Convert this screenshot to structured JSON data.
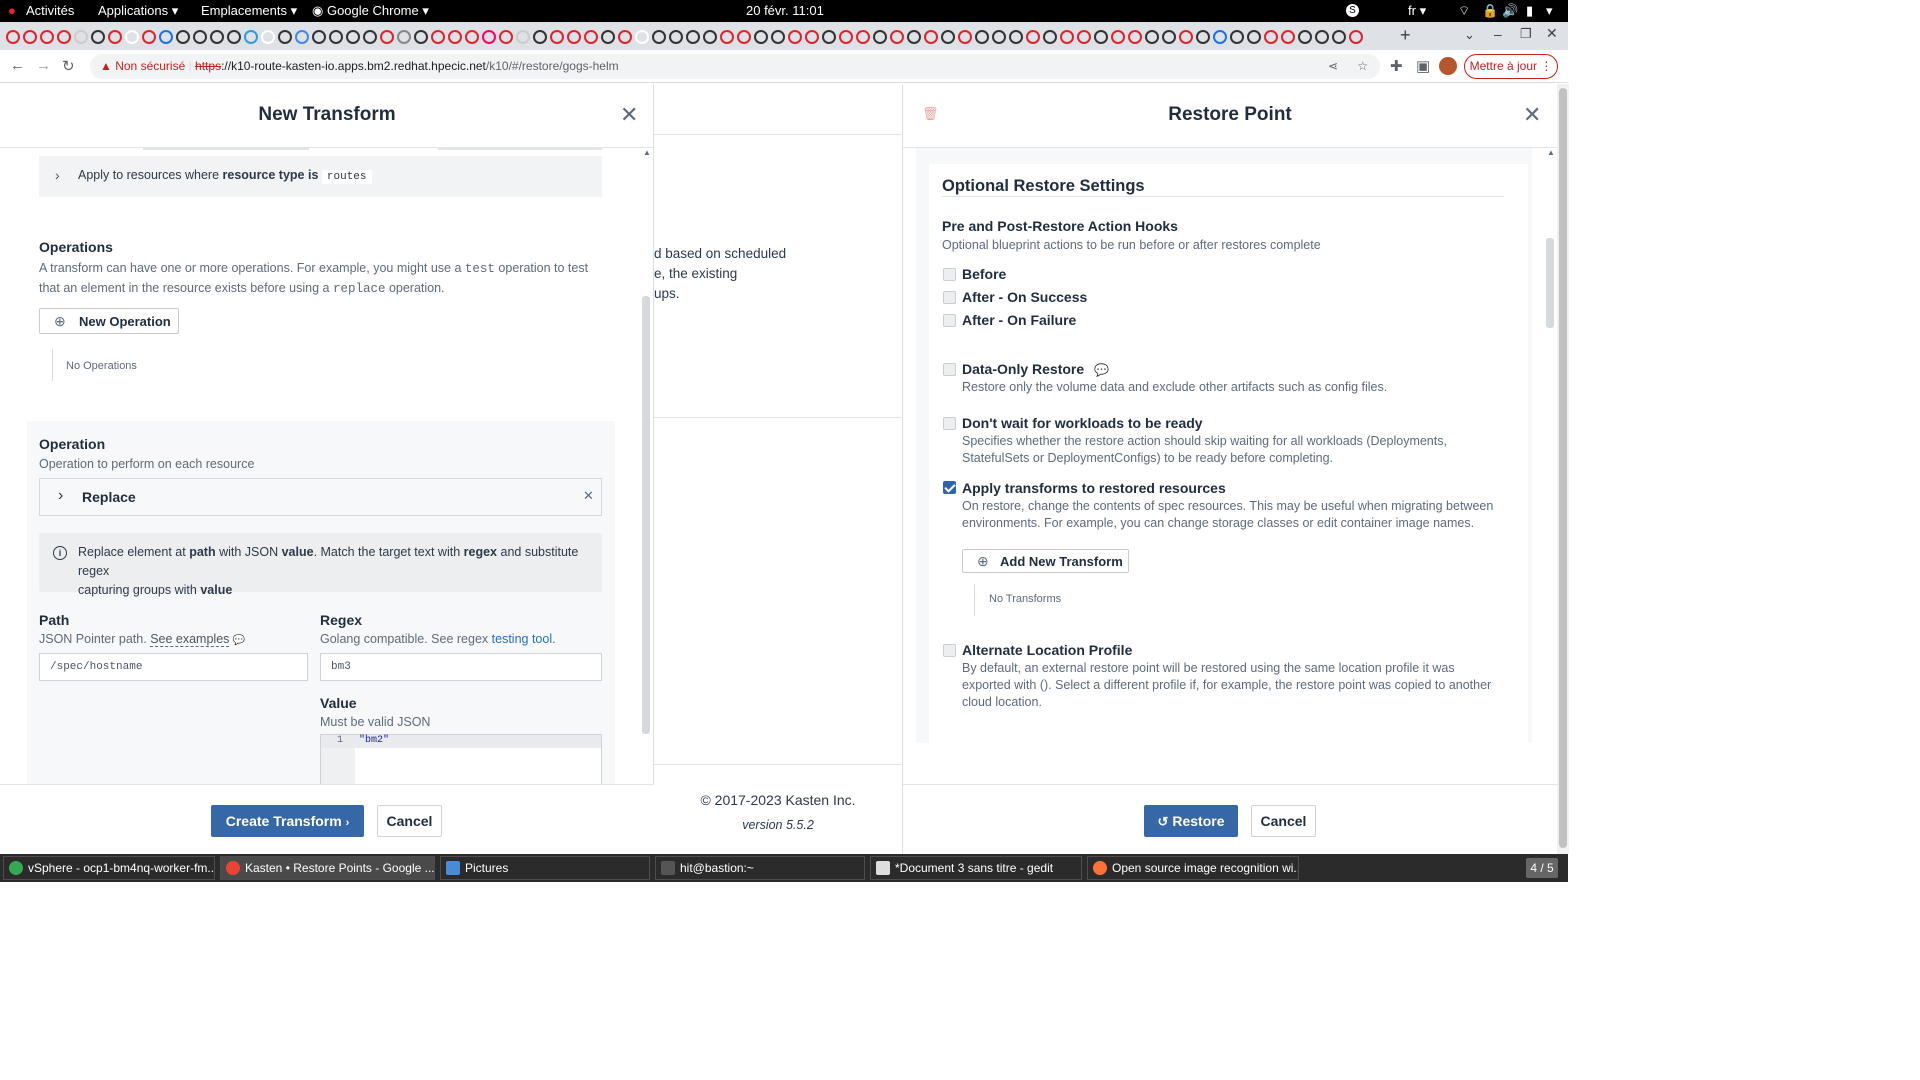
{
  "system_bar": {
    "activities": "Activités",
    "applications": "Applications",
    "places": "Emplacements",
    "chrome": "Google Chrome",
    "clock": "20 févr.  11:01",
    "lang": "fr"
  },
  "browser": {
    "not_secure": "Non sécurisé",
    "url_scheme": "https",
    "url_host": "://k10-route-kasten-io.apps.bm2.redhat.hpecic.net",
    "url_path": "/k10/#/restore/gogs-helm",
    "update_button": "Mettre à jour"
  },
  "transform_panel": {
    "title": "New Transform",
    "apply_prefix": "Apply to resources where",
    "apply_key": "resource type is",
    "apply_value": "routes",
    "operations_title": "Operations",
    "operations_desc_1": "A transform can have one or more operations. For example, you might use a",
    "operations_desc_code1": "test",
    "operations_desc_2": "operation to test",
    "operations_desc_3": "that an element in the resource exists before using a",
    "operations_desc_code2": "replace",
    "operations_desc_4": "operation.",
    "new_operation_button": "New Operation",
    "no_operations": "No Operations",
    "operation_title": "Operation",
    "operation_desc": "Operation to perform on each resource",
    "operation_type": "Replace",
    "info_1": "Replace element at",
    "info_path": "path",
    "info_2": "with JSON",
    "info_value": "value",
    "info_3": ". Match the target text with",
    "info_regex": "regex",
    "info_4": "and substitute regex",
    "info_5": "capturing groups with",
    "info_value2": "value",
    "path_label": "Path",
    "path_help": "JSON Pointer path.",
    "path_examples_link": "See examples",
    "path_value": "/spec/hostname",
    "regex_label": "Regex",
    "regex_help": "Golang compatible. See regex",
    "regex_link": "testing tool",
    "regex_help_end": ".",
    "regex_value": "bm3",
    "value_label": "Value",
    "value_help": "Must be valid JSON",
    "editor_line_number": "1",
    "editor_content": "\"bm2\"",
    "create_button": "Create Transform",
    "cancel_button": "Cancel"
  },
  "background_panel": {
    "text_1": "d based on scheduled",
    "text_2": "e, the existing",
    "text_3": "ups.",
    "copyright": "© 2017-2023 Kasten Inc.",
    "version": "version 5.5.2"
  },
  "restore_panel": {
    "title": "Restore Point",
    "section_title": "Optional Restore Settings",
    "hooks_title": "Pre and Post-Restore Action Hooks",
    "hooks_desc": "Optional blueprint actions to be run before or after restores complete",
    "before": "Before",
    "after_success": "After - On Success",
    "after_failure": "After - On Failure",
    "data_only": "Data-Only Restore",
    "data_only_desc": "Restore only the volume data and exclude other artifacts such as config files.",
    "dont_wait": "Don't wait for workloads to be ready",
    "dont_wait_desc_1": "Specifies whether the restore action should skip waiting for all workloads (Deployments,",
    "dont_wait_desc_2": "StatefulSets or DeploymentConfigs) to be ready before completing.",
    "apply_transforms": "Apply transforms to restored resources",
    "apply_transforms_checked": true,
    "apply_transforms_desc_1": "On restore, change the contents of spec resources. This may be useful when migrating between",
    "apply_transforms_desc_2": "environments. For example, you can change storage classes or edit container image names.",
    "add_transform_button": "Add New Transform",
    "no_transforms": "No Transforms",
    "alt_location": "Alternate Location Profile",
    "alt_location_desc_1": "By default, an external restore point will be restored using the same location profile it was",
    "alt_location_desc_2": "exported with (). Select a different profile if, for example, the restore point was copied to another",
    "alt_location_desc_3": "cloud location.",
    "restore_button": "Restore",
    "cancel_button": "Cancel"
  },
  "taskbar": {
    "items": [
      "vSphere - ocp1-bm4nq-worker-fm...",
      "Kasten • Restore Points - Google ...",
      "Pictures",
      "hit@bastion:~",
      "*Document 3 sans titre - gedit",
      "Open source image recognition wi..."
    ],
    "workspace": "4 / 5"
  },
  "colors": {
    "accent": "#3667a6",
    "link": "#2a6ebb",
    "checkbox_on": "#2f65b0",
    "warning": "#c5221f"
  }
}
